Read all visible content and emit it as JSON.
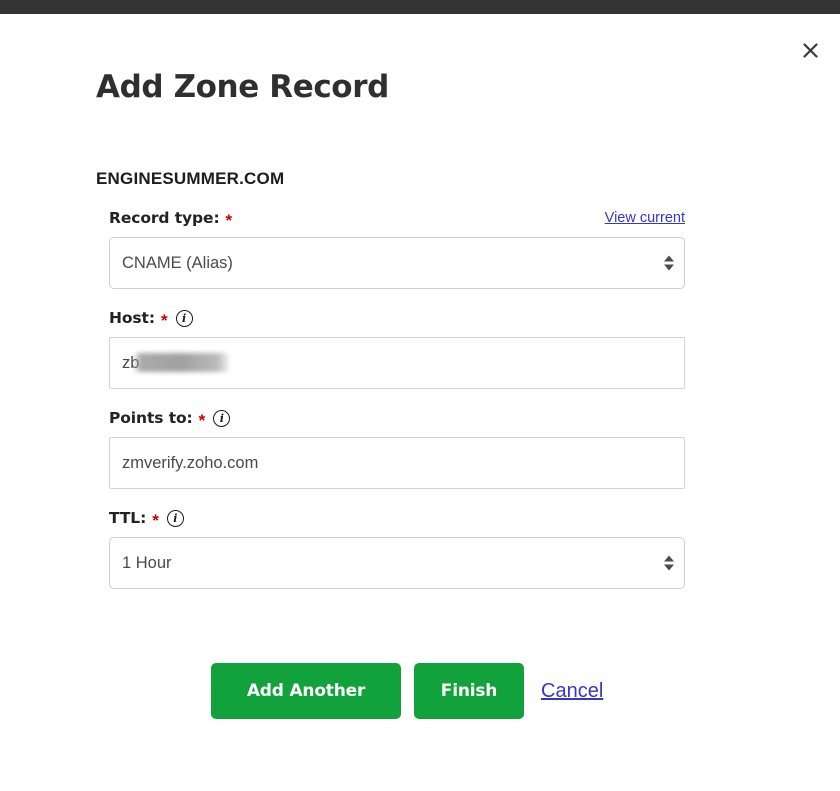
{
  "window": {
    "top_bar_color": "#333333"
  },
  "modal": {
    "title": "Add Zone Record",
    "zone_name": "ENGINESUMMER.COM",
    "close_label": "×"
  },
  "form": {
    "record_type": {
      "label": "Record type:",
      "required_mark": "*",
      "value": "CNAME (Alias)",
      "options": [
        "CNAME (Alias)"
      ],
      "view_current_label": "View current"
    },
    "host": {
      "label": "Host:",
      "required_mark": "*",
      "info_glyph": "i",
      "value": "zb",
      "redacted": true
    },
    "points_to": {
      "label": "Points to:",
      "required_mark": "*",
      "info_glyph": "i",
      "value": "zmverify.zoho.com"
    },
    "ttl": {
      "label": "TTL:",
      "required_mark": "*",
      "info_glyph": "i",
      "value": "1 Hour",
      "options": [
        "1 Hour"
      ]
    }
  },
  "actions": {
    "add_another_label": "Add Another",
    "finish_label": "Finish",
    "cancel_label": "Cancel"
  },
  "colors": {
    "primary_green": "#12a23c",
    "link_blue": "#3636c8",
    "required_red": "#cc0000",
    "text_dark": "#222222"
  }
}
